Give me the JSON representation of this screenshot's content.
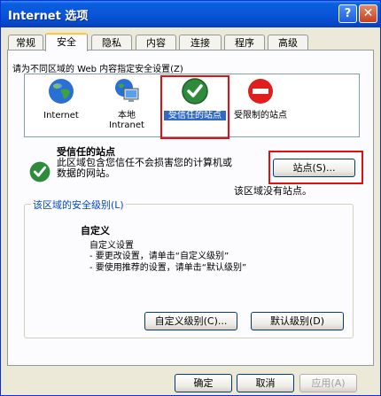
{
  "window": {
    "title": "Internet 选项",
    "help_glyph": "?",
    "close_glyph": "✕"
  },
  "tabs": [
    {
      "label": "常规"
    },
    {
      "label": "安全",
      "active": true
    },
    {
      "label": "隐私"
    },
    {
      "label": "内容"
    },
    {
      "label": "连接"
    },
    {
      "label": "程序"
    },
    {
      "label": "高级"
    }
  ],
  "security": {
    "zone_prompt": "请为不同区域的 Web 内容指定安全设置(Z)",
    "zones": [
      {
        "name": "Internet",
        "icon": "globe-icon"
      },
      {
        "name": "本地\nIntranet",
        "icon": "intranet-monitor-icon"
      },
      {
        "name": "受信任的站点",
        "icon": "trusted-check-icon",
        "selected": true
      },
      {
        "name": "受限制的站点",
        "icon": "restricted-no-icon"
      }
    ],
    "selected_zone_title": "受信任的站点",
    "selected_zone_desc": "此区域包含您信任不会损害您的计算机或数据的网站。",
    "sites_button": "站点(S)...",
    "no_sites": "该区域没有站点。",
    "level_group_label": "该区域的安全级别(L)",
    "level_title": "自定义",
    "level_lines": [
      "自定义设置",
      "- 要更改设置，请单击“自定义级别”",
      "- 要使用推荐的设置，请单击“默认级别”"
    ],
    "custom_level_button": "自定义级别(C)...",
    "default_level_button": "默认级别(D)"
  },
  "footer": {
    "ok": "确定",
    "cancel": "取消",
    "apply": "应用(A)"
  },
  "colors": {
    "titlebar": "#0a55d8",
    "selection": "#316ac5",
    "highlight_box": "#e01010"
  }
}
